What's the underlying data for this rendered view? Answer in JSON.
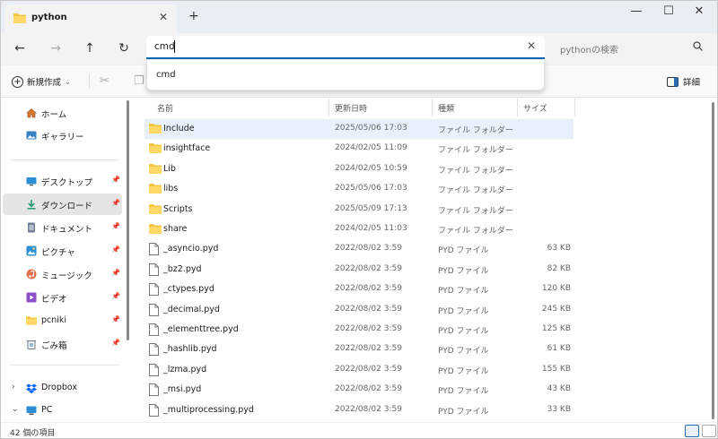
{
  "tab": {
    "title": "python"
  },
  "address": {
    "value": "cmd",
    "suggestion": "cmd"
  },
  "search": {
    "placeholder": "pythonの検索"
  },
  "toolbar": {
    "new_label": "新規作成",
    "details_label": "詳細"
  },
  "sidebar": {
    "top": [
      {
        "label": "ホーム",
        "icon": "home-icon"
      },
      {
        "label": "ギャラリー",
        "icon": "gallery-icon"
      }
    ],
    "quick": [
      {
        "label": "デスクトップ",
        "icon": "desktop-icon",
        "pinned": true
      },
      {
        "label": "ダウンロード",
        "icon": "download-icon",
        "pinned": true,
        "selected": true
      },
      {
        "label": "ドキュメント",
        "icon": "documents-icon",
        "pinned": true
      },
      {
        "label": "ピクチャ",
        "icon": "pictures-icon",
        "pinned": true
      },
      {
        "label": "ミュージック",
        "icon": "music-icon",
        "pinned": true
      },
      {
        "label": "ビデオ",
        "icon": "videos-icon",
        "pinned": true
      },
      {
        "label": "pcniki",
        "icon": "folder-icon",
        "pinned": true
      },
      {
        "label": "ごみ箱",
        "icon": "recycle-bin-icon",
        "pinned": true
      }
    ],
    "bottom": [
      {
        "label": "Dropbox",
        "icon": "dropbox-icon",
        "expand": "collapsed"
      },
      {
        "label": "PC",
        "icon": "pc-icon",
        "expand": "expanded"
      }
    ]
  },
  "columns": {
    "name": "名前",
    "date": "更新日時",
    "type": "種類",
    "size": "サイズ"
  },
  "files": [
    {
      "name": "Include",
      "date": "2025/05/06 17:03",
      "type": "ファイル フォルダー",
      "size": "",
      "kind": "folder",
      "selected": true
    },
    {
      "name": "insightface",
      "date": "2024/02/05 11:09",
      "type": "ファイル フォルダー",
      "size": "",
      "kind": "folder"
    },
    {
      "name": "Lib",
      "date": "2024/02/05 10:59",
      "type": "ファイル フォルダー",
      "size": "",
      "kind": "folder"
    },
    {
      "name": "libs",
      "date": "2025/05/06 17:03",
      "type": "ファイル フォルダー",
      "size": "",
      "kind": "folder"
    },
    {
      "name": "Scripts",
      "date": "2025/05/09 17:13",
      "type": "ファイル フォルダー",
      "size": "",
      "kind": "folder"
    },
    {
      "name": "share",
      "date": "2024/02/05 11:03",
      "type": "ファイル フォルダー",
      "size": "",
      "kind": "folder"
    },
    {
      "name": "_asyncio.pyd",
      "date": "2022/08/02 3:59",
      "type": "PYD ファイル",
      "size": "63 KB",
      "kind": "file"
    },
    {
      "name": "_bz2.pyd",
      "date": "2022/08/02 3:59",
      "type": "PYD ファイル",
      "size": "82 KB",
      "kind": "file"
    },
    {
      "name": "_ctypes.pyd",
      "date": "2022/08/02 3:59",
      "type": "PYD ファイル",
      "size": "120 KB",
      "kind": "file"
    },
    {
      "name": "_decimal.pyd",
      "date": "2022/08/02 3:59",
      "type": "PYD ファイル",
      "size": "245 KB",
      "kind": "file"
    },
    {
      "name": "_elementtree.pyd",
      "date": "2022/08/02 3:59",
      "type": "PYD ファイル",
      "size": "125 KB",
      "kind": "file"
    },
    {
      "name": "_hashlib.pyd",
      "date": "2022/08/02 3:59",
      "type": "PYD ファイル",
      "size": "61 KB",
      "kind": "file"
    },
    {
      "name": "_lzma.pyd",
      "date": "2022/08/02 3:59",
      "type": "PYD ファイル",
      "size": "155 KB",
      "kind": "file"
    },
    {
      "name": "_msi.pyd",
      "date": "2022/08/02 3:59",
      "type": "PYD ファイル",
      "size": "43 KB",
      "kind": "file"
    },
    {
      "name": "_multiprocessing.pyd",
      "date": "2022/08/02 3:59",
      "type": "PYD ファイル",
      "size": "33 KB",
      "kind": "file"
    }
  ],
  "status": {
    "count_text": "42 個の項目"
  },
  "colors": {
    "accent": "#0a64b4",
    "folder": "#f4c542",
    "selected_row": "#e8f1fb"
  }
}
